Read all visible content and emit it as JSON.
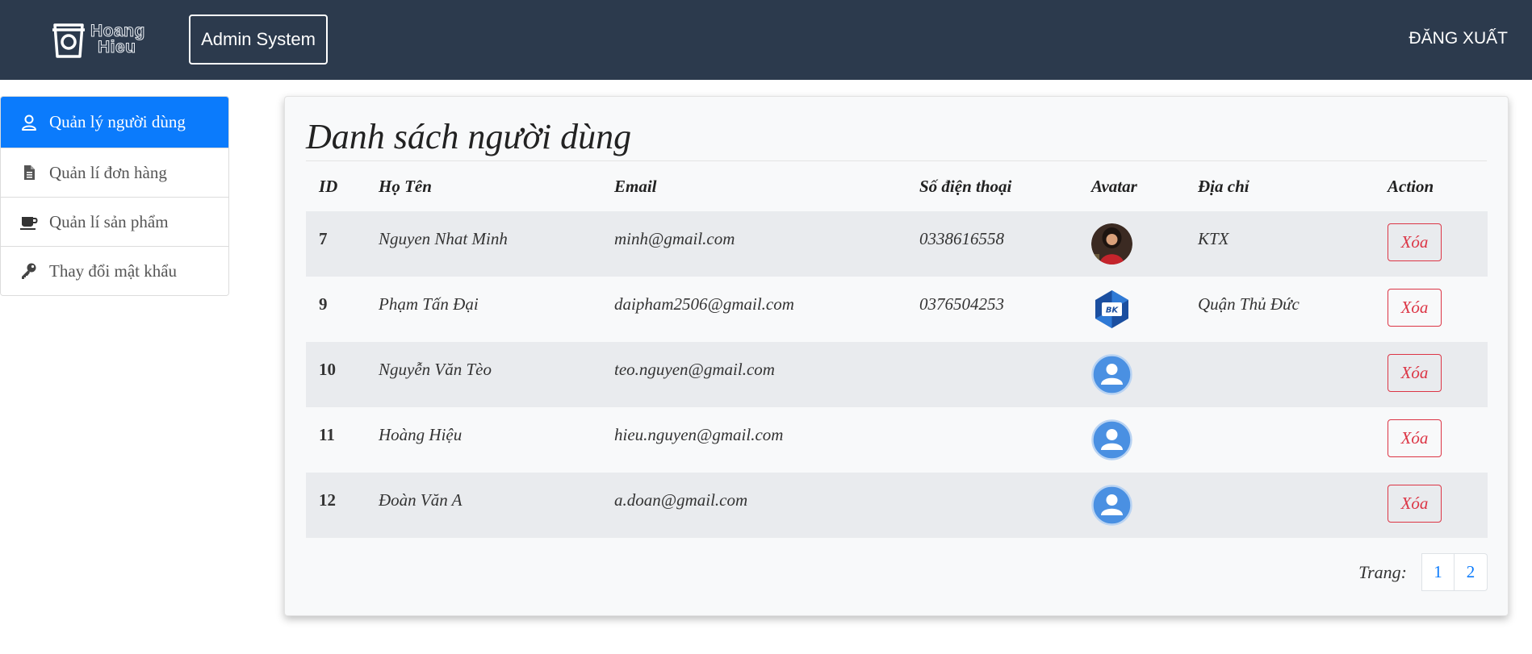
{
  "header": {
    "logo_line1": "Hoang",
    "logo_line2": "Hieu",
    "brand": "Admin System",
    "logout": "ĐĂNG XUẤT"
  },
  "sidebar": {
    "items": [
      {
        "label": "Quản lý người dùng",
        "icon": "user-icon",
        "active": true
      },
      {
        "label": "Quản lí đơn hàng",
        "icon": "file-icon",
        "active": false
      },
      {
        "label": "Quản lí sản phẩm",
        "icon": "coffee-cup-icon",
        "active": false
      },
      {
        "label": "Thay đổi mật khẩu",
        "icon": "key-icon",
        "active": false
      }
    ]
  },
  "main": {
    "title": "Danh sách người dùng",
    "table": {
      "headers": [
        "ID",
        "Họ Tên",
        "Email",
        "Số điện thoại",
        "Avatar",
        "Địa chỉ",
        "Action"
      ],
      "rows": [
        {
          "id": "7",
          "name": "Nguyen Nhat Minh",
          "email": "minh@gmail.com",
          "phone": "0338616558",
          "avatar": "photo-avatar",
          "address": "KTX",
          "action": "Xóa"
        },
        {
          "id": "9",
          "name": "Phạm Tấn Đại",
          "email": "daipham2506@gmail.com",
          "phone": "0376504253",
          "avatar": "bk-logo-avatar",
          "address": "Quận Thủ Đức",
          "action": "Xóa"
        },
        {
          "id": "10",
          "name": "Nguyễn Văn Tèo",
          "email": "teo.nguyen@gmail.com",
          "phone": "",
          "avatar": "default-avatar",
          "address": "",
          "action": "Xóa"
        },
        {
          "id": "11",
          "name": "Hoàng Hiệu",
          "email": "hieu.nguyen@gmail.com",
          "phone": "",
          "avatar": "default-avatar",
          "address": "",
          "action": "Xóa"
        },
        {
          "id": "12",
          "name": "Đoàn Văn A",
          "email": "a.doan@gmail.com",
          "phone": "",
          "avatar": "default-avatar",
          "address": "",
          "action": "Xóa"
        }
      ]
    },
    "pagination": {
      "label": "Trang:",
      "pages": [
        "1",
        "2"
      ]
    }
  },
  "colors": {
    "header_bg": "#2c3a4d",
    "active": "#0b7bfc",
    "danger": "#dc3545",
    "avatar_default": "#4a90e2"
  }
}
